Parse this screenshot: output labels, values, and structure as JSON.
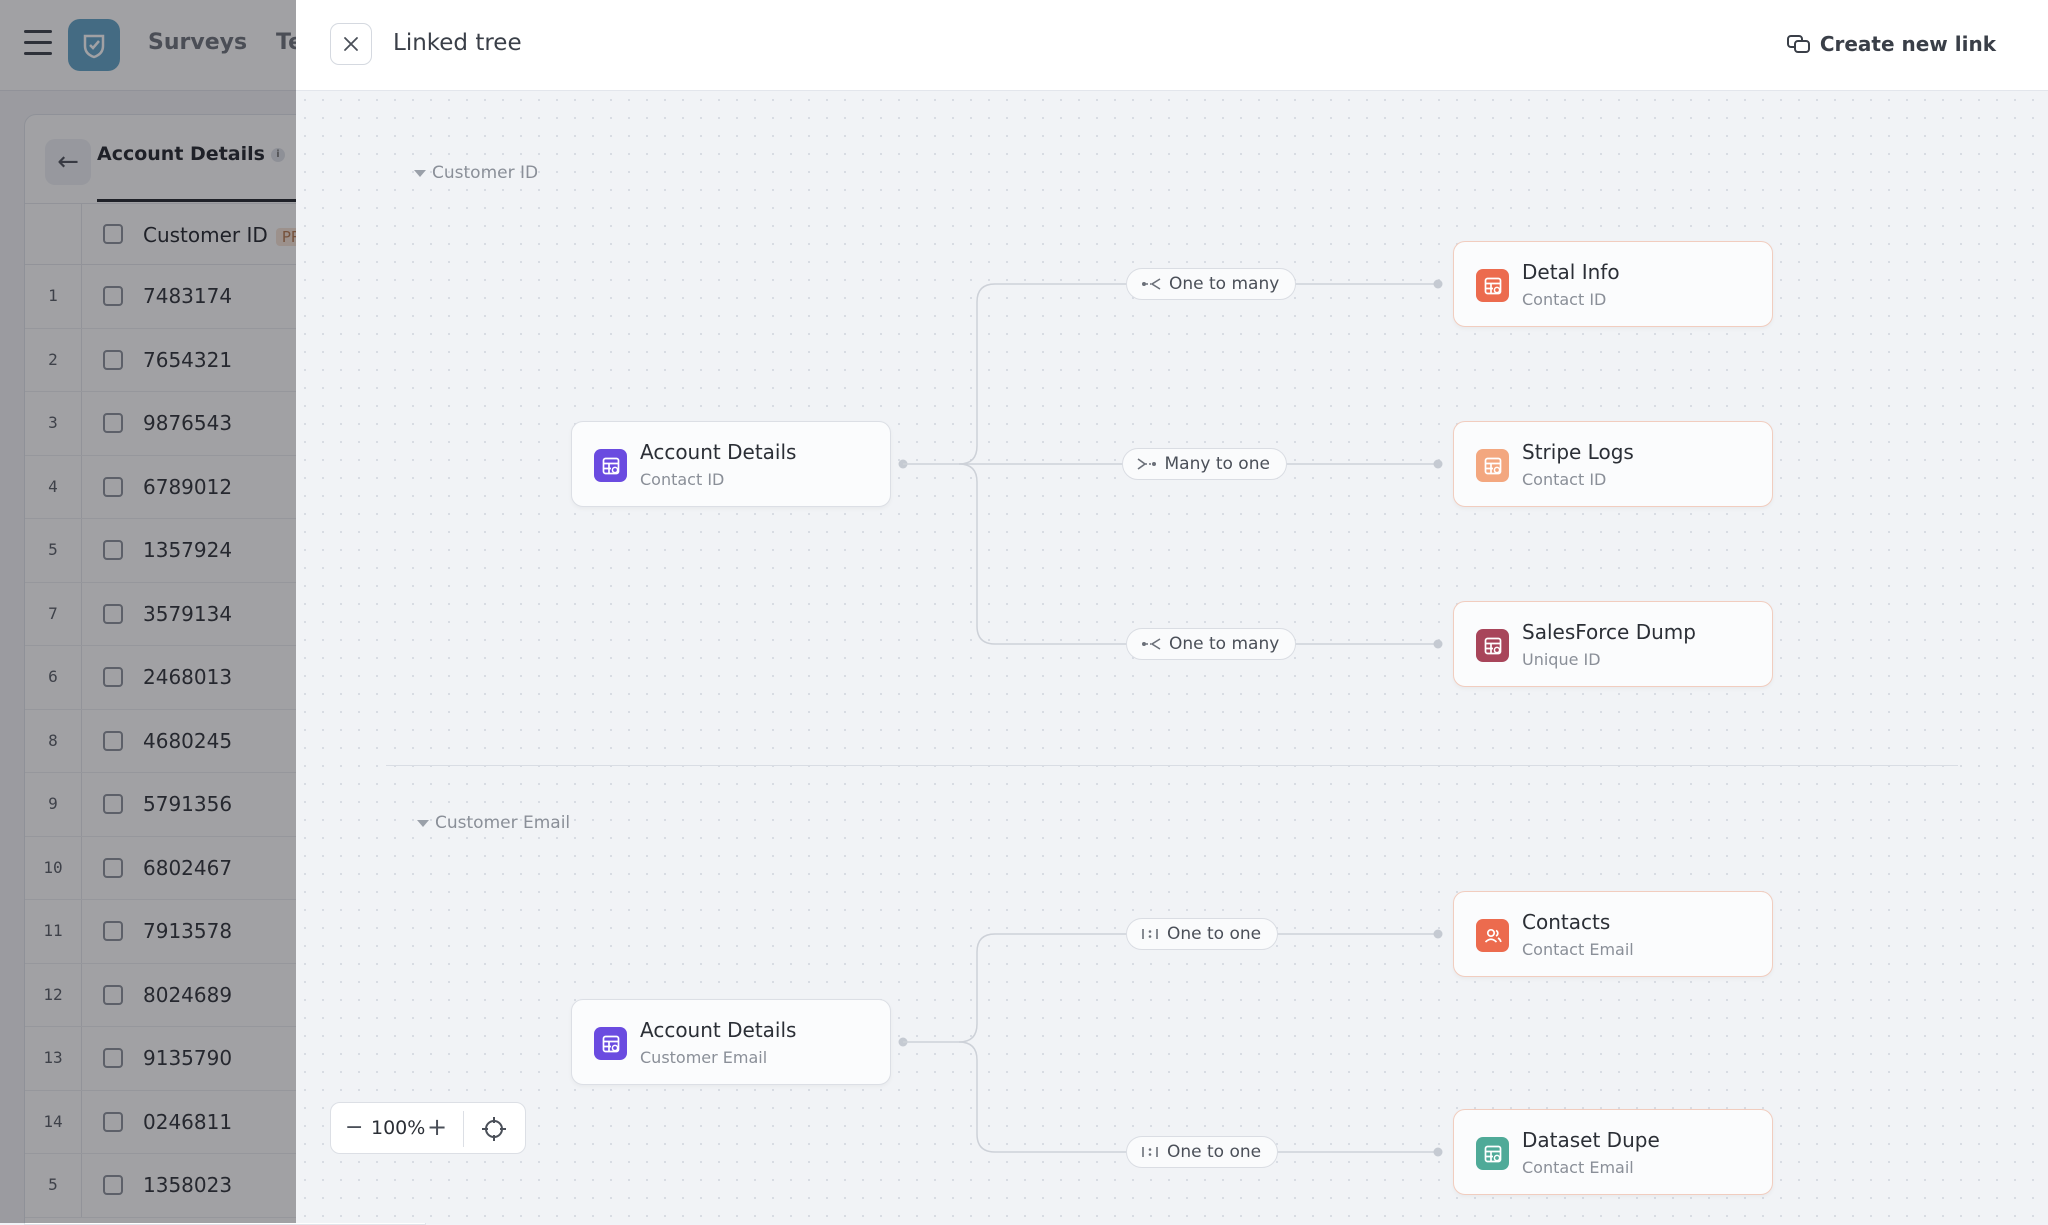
{
  "background": {
    "nav": [
      "Surveys",
      "Te"
    ],
    "tab_label": "Account Details",
    "column_header": "Customer ID",
    "column_tag": "PR",
    "rows": [
      {
        "num": "1",
        "value": "7483174"
      },
      {
        "num": "2",
        "value": "7654321"
      },
      {
        "num": "3",
        "value": "9876543"
      },
      {
        "num": "4",
        "value": "6789012"
      },
      {
        "num": "5",
        "value": "1357924"
      },
      {
        "num": "7",
        "value": "3579134"
      },
      {
        "num": "6",
        "value": "2468013"
      },
      {
        "num": "8",
        "value": "4680245"
      },
      {
        "num": "9",
        "value": "5791356"
      },
      {
        "num": "10",
        "value": "6802467"
      },
      {
        "num": "11",
        "value": "7913578"
      },
      {
        "num": "12",
        "value": "8024689"
      },
      {
        "num": "13",
        "value": "9135790"
      },
      {
        "num": "14",
        "value": "0246811"
      },
      {
        "num": "5",
        "value": "1358023"
      }
    ]
  },
  "modal": {
    "title": "Linked tree",
    "create_link_label": "Create new link",
    "close_icon": "close-icon",
    "zoom_level": "100%"
  },
  "sections": [
    {
      "label": "Customer ID",
      "source": {
        "title": "Account Details",
        "field": "Contact ID",
        "icon": "table-icon",
        "color": "#6a4be0"
      },
      "links": [
        {
          "relation": "One to many",
          "relation_icon": "one-to-many-icon",
          "target": {
            "title": "Detal Info",
            "field": "Contact ID",
            "icon": "table-icon",
            "color": "#ec6b4e"
          }
        },
        {
          "relation": "Many to one",
          "relation_icon": "many-to-one-icon",
          "target": {
            "title": "Stripe Logs",
            "field": "Contact ID",
            "icon": "table-icon",
            "color": "#f3a77f"
          }
        },
        {
          "relation": "One to many",
          "relation_icon": "one-to-many-icon",
          "target": {
            "title": "SalesForce Dump",
            "field": "Unique ID",
            "icon": "table-icon",
            "color": "#a8455a"
          }
        }
      ]
    },
    {
      "label": "Customer Email",
      "source": {
        "title": "Account Details",
        "field": "Customer Email",
        "icon": "table-icon",
        "color": "#6a4be0"
      },
      "links": [
        {
          "relation": "One to one",
          "relation_icon": "one-to-one-icon",
          "target": {
            "title": "Contacts",
            "field": "Contact Email",
            "icon": "users-icon",
            "color": "#ec6b4e"
          }
        },
        {
          "relation": "One to one",
          "relation_icon": "one-to-one-icon",
          "target": {
            "title": "Dataset Dupe",
            "field": "Contact Email",
            "icon": "table-icon",
            "color": "#4faa98"
          }
        }
      ]
    }
  ]
}
